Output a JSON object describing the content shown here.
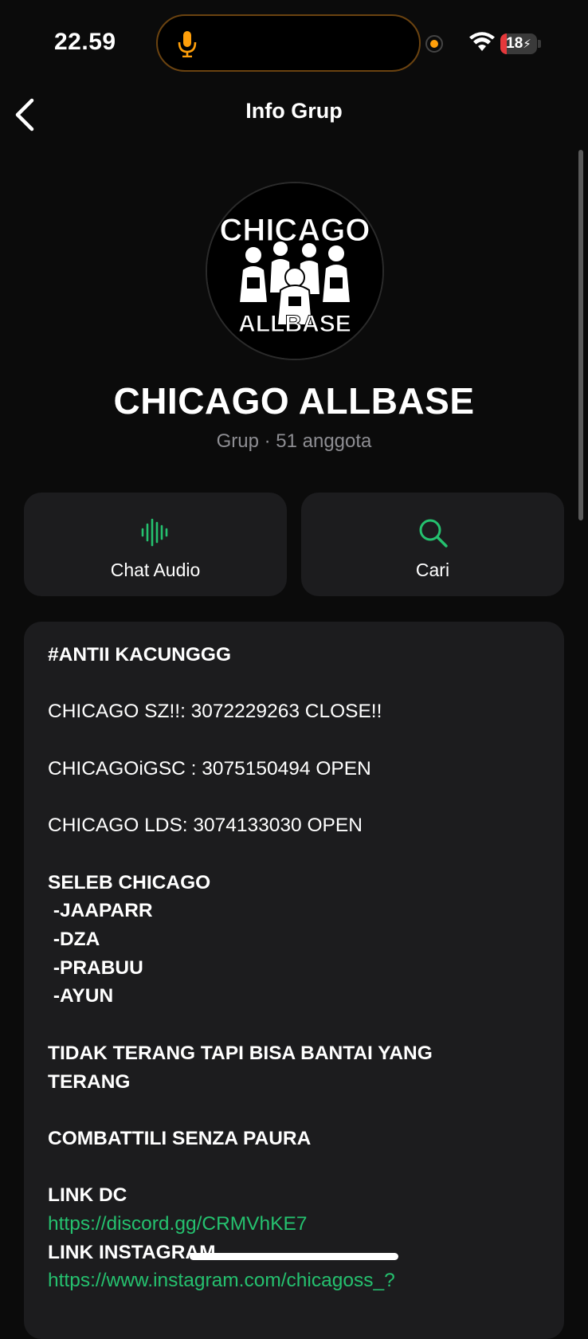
{
  "status_bar": {
    "time": "22.59",
    "battery": "18",
    "battery_level": 0.18,
    "colors": {
      "mic": "#ff9f0a",
      "battery_low": "#e5383b"
    }
  },
  "nav": {
    "title": "Info Grup",
    "back_icon": "chevron-left-icon"
  },
  "group": {
    "name": "CHICAGO ALLBASE",
    "meta": "Grup · 51 anggota",
    "avatar": {
      "top_text": "CHICAGO",
      "bottom_text": "ALLBASE"
    }
  },
  "actions": [
    {
      "label": "Chat Audio",
      "icon": "audio-waveform-icon"
    },
    {
      "label": "Cari",
      "icon": "search-icon"
    }
  ],
  "accent_color": "#25c16f",
  "description": {
    "heading": "#ANTII KACUNGGG",
    "line1": "CHICAGO SZ!!: 3072229263 CLOSE!!",
    "line2": "CHICAGOiGSC : 3075150494 OPEN",
    "line3": "CHICAGO LDS: 3074133030 OPEN",
    "seleb_title": "SELEB CHICAGO",
    "seleb_1": " -JAAPARR",
    "seleb_2": " -DZA",
    "seleb_3": " -PRABUU",
    "seleb_4": " -AYUN",
    "motto": "TIDAK TERANG TAPI BISA BANTAI YANG\nTERANG",
    "motto2": "COMBATTILI SENZA PAURA",
    "link_dc_label": "LINK DC",
    "link_dc": "https://discord.gg/CRMVhKE7",
    "link_ig_label": "LINK INSTAGRAM",
    "link_ig": "https://www.instagram.com/chicagoss_?"
  }
}
